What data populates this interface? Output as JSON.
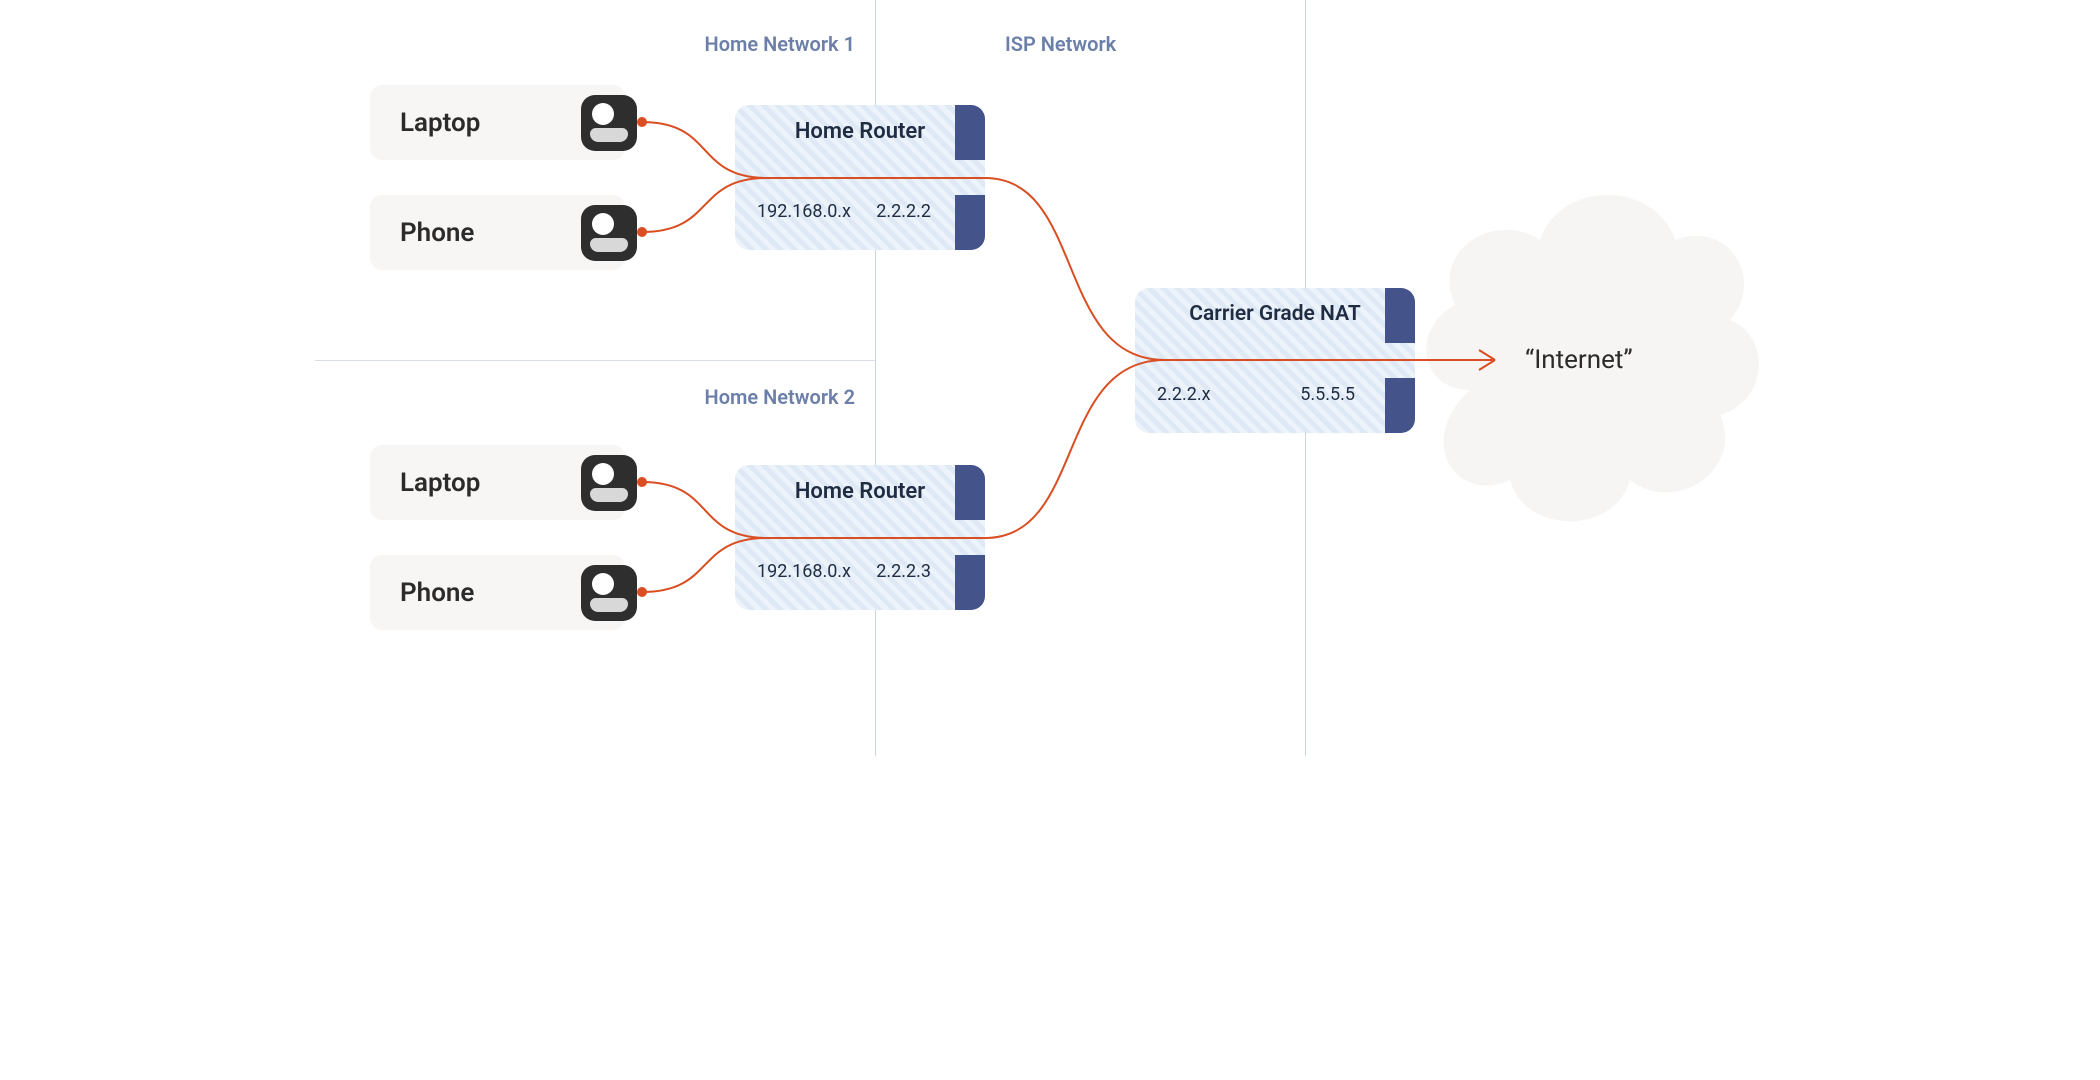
{
  "sections": {
    "home1": "Home Network 1",
    "home2": "Home Network 2",
    "isp": "ISP Network"
  },
  "devices": {
    "n1_laptop": "Laptop",
    "n1_phone": "Phone",
    "n2_laptop": "Laptop",
    "n2_phone": "Phone"
  },
  "routers": {
    "r1": {
      "title": "Home Router",
      "lan_ip": "192.168.0.x",
      "wan_ip": "2.2.2.2"
    },
    "r2": {
      "title": "Home Router",
      "lan_ip": "192.168.0.x",
      "wan_ip": "2.2.2.3"
    },
    "cgn": {
      "title": "Carrier Grade NAT",
      "lan_ip": "2.2.2.x",
      "wan_ip": "5.5.5.5"
    }
  },
  "internet": "“Internet”",
  "icons": {
    "device": "device-icon",
    "cloud": "cloud-icon"
  }
}
